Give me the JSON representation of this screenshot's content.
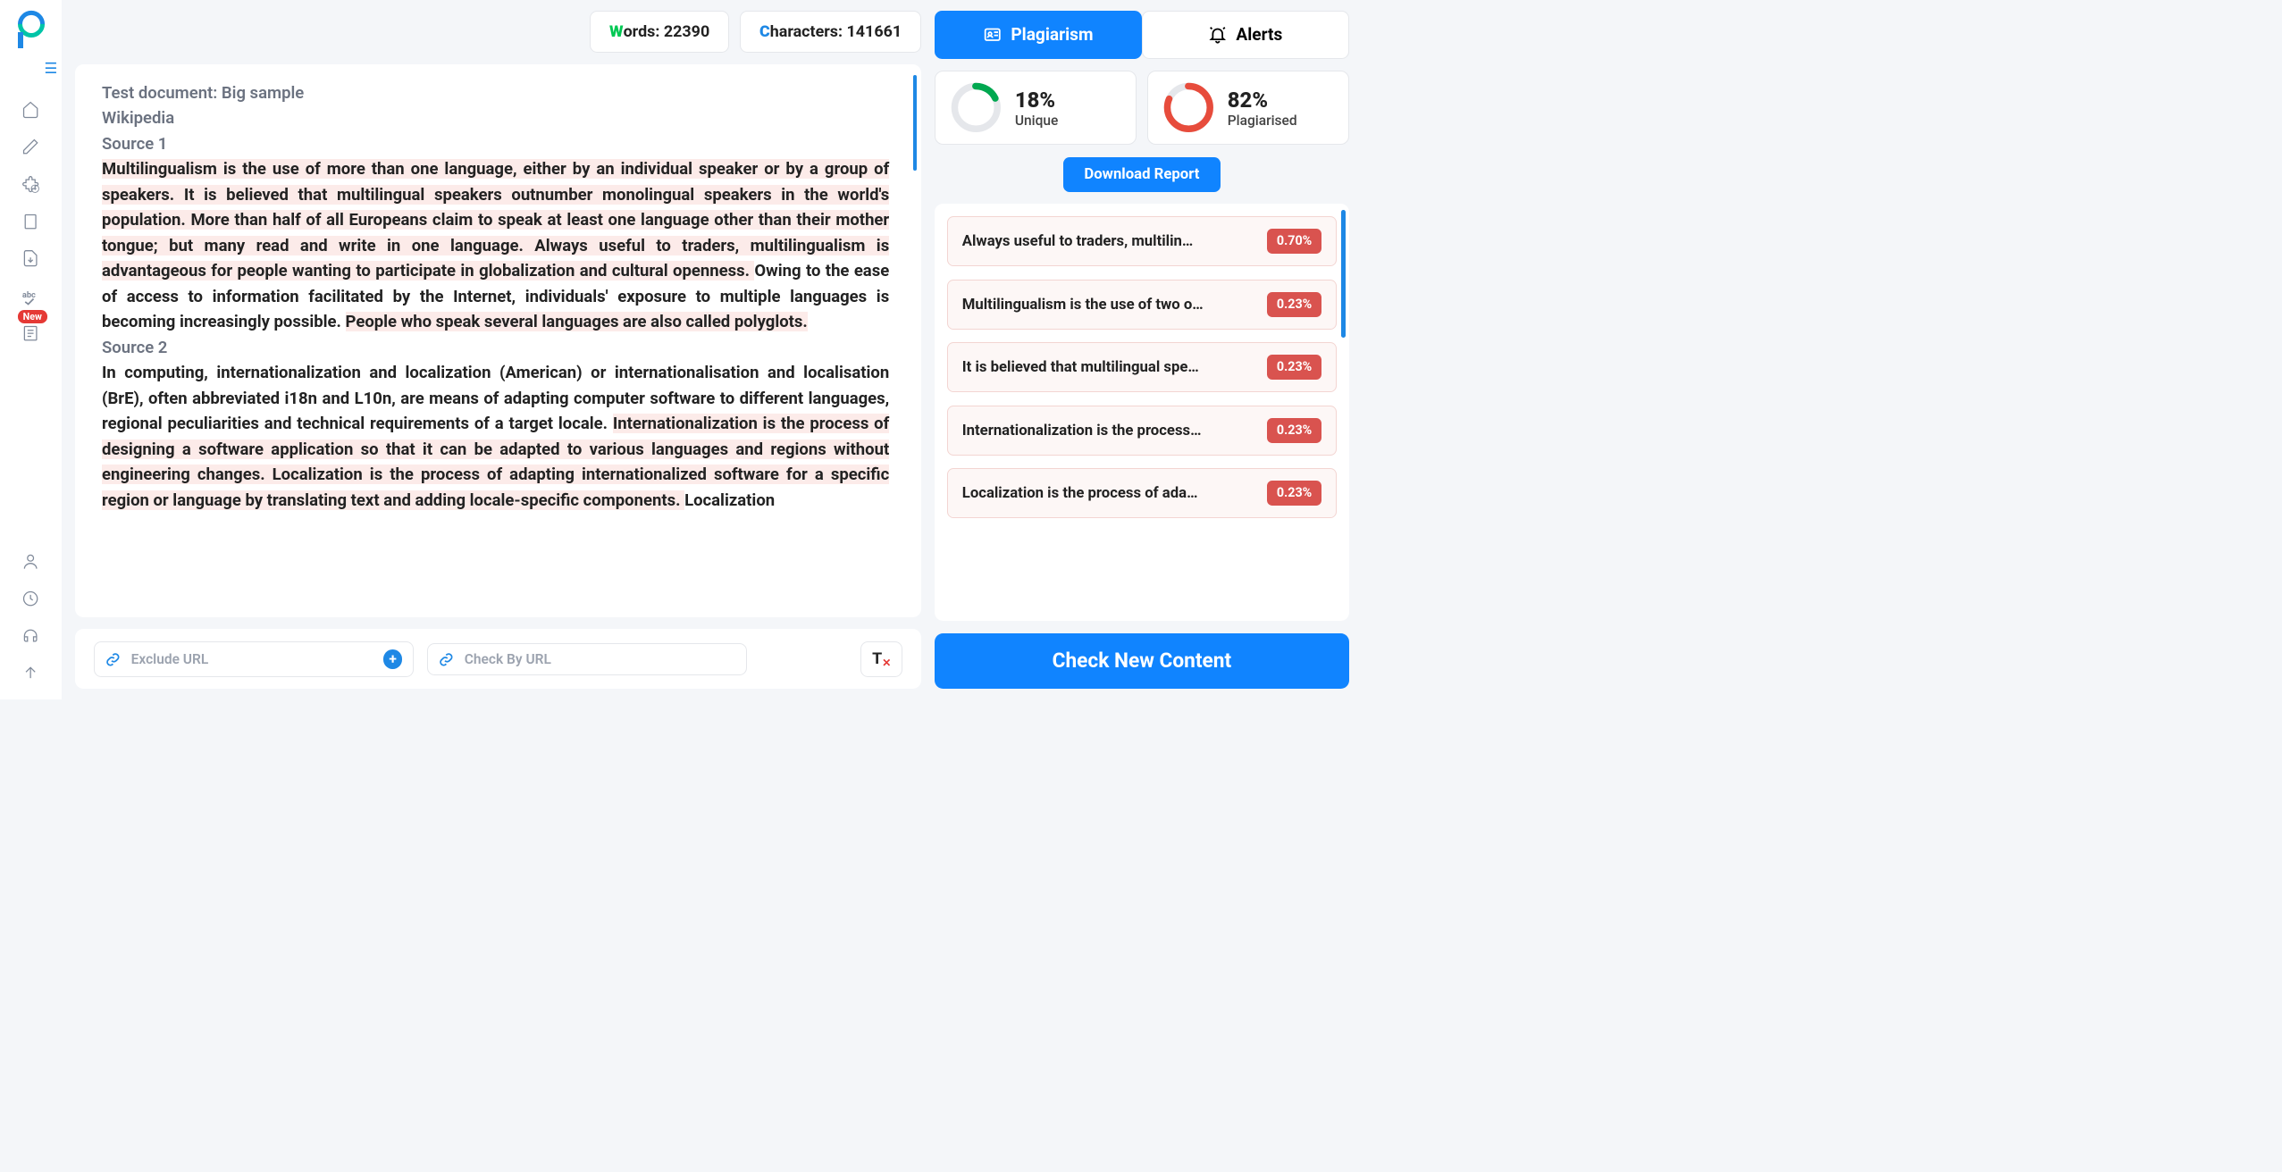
{
  "stats": {
    "words_label_prefix": "W",
    "words_label": "ords:",
    "words_value": "22390",
    "chars_label_prefix": "C",
    "chars_label": "haracters:",
    "chars_value": "141661"
  },
  "tabs": {
    "plagiarism": "Plagiarism",
    "alerts": "Alerts"
  },
  "gauges": {
    "unique_pct": "18%",
    "unique_label": "Unique",
    "plag_pct": "82%",
    "plag_label": "Plagiarised"
  },
  "download_btn": "Download Report",
  "check_btn": "Check New Content",
  "exclude_url_placeholder": "Exclude URL",
  "check_by_url_placeholder": "Check By URL",
  "sidebar_badge": "New",
  "editor": {
    "line1": "Test document: Big sample",
    "line2": "Wikipedia",
    "line3": "Source 1",
    "p1a": "Multilingualism is the use of more than one language, either by an individual speaker or by a group of speakers. ",
    "p1b": "It is believed that multilingual speakers outnumber monolingual speakers in the world's population. ",
    "p1c": "More than half of all Europeans claim to speak at least one language other than their mother tongue; but many read and write in one language. Always useful to traders, multilingualism is advantageous for people wanting to participate in globalization and cultural openness. ",
    "p1d": "Owing to the ease of access to information facilitated by the Internet, individuals' exposure to multiple languages is becoming increasingly possible. ",
    "p1e": "People who speak several languages are also called polyglots.",
    "line4": "Source 2",
    "p2a": "In computing, internationalization and localization (American) or internationalisation and localisation (BrE), often abbreviated i18n and L10n, are means of adapting computer software to different languages, regional peculiarities and technical requirements of a target locale. ",
    "p2b": "Internationalization is the process of designing a software application so that it can be adapted to various languages and regions without engineering changes. Localization is the process of adapting internationalized software for a specific region or language by translating text and adding locale-specific components. ",
    "p2c": "Localization"
  },
  "results": [
    {
      "text": "Always useful to traders, multilin…",
      "pct": "0.70%"
    },
    {
      "text": "Multilingualism is the use of two o…",
      "pct": "0.23%"
    },
    {
      "text": "It is believed that multilingual spe…",
      "pct": "0.23%"
    },
    {
      "text": "Internationalization is the process…",
      "pct": "0.23%"
    },
    {
      "text": "Localization is the process of ada…",
      "pct": "0.23%"
    }
  ]
}
